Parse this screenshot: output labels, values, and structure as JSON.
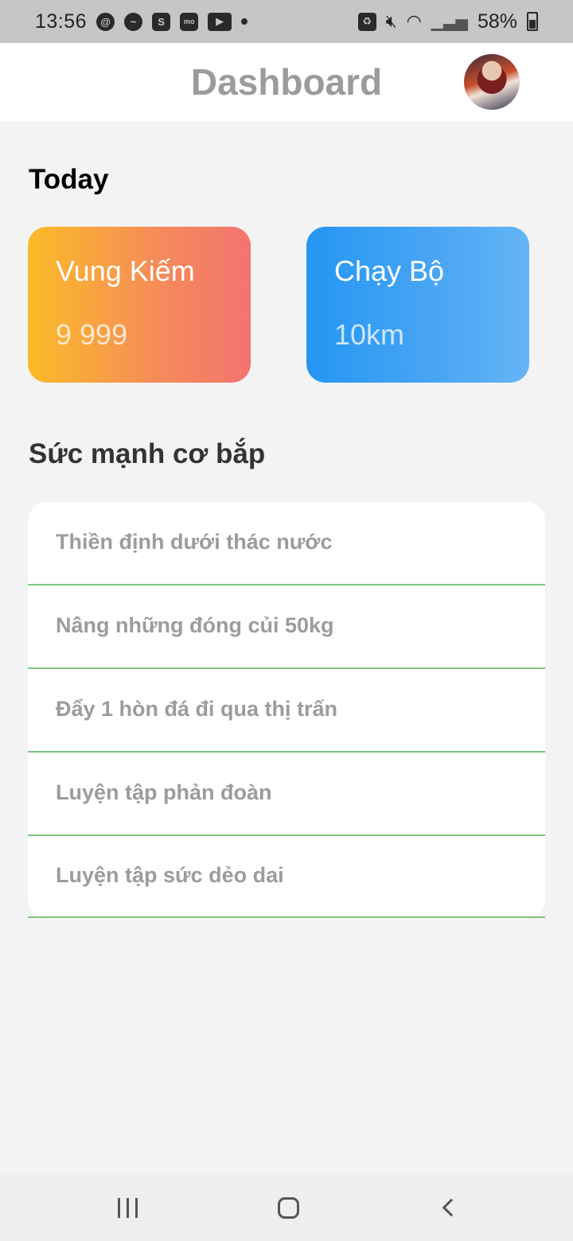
{
  "status_bar": {
    "time": "13:56",
    "battery_pct": "58%",
    "icons": [
      "threads-icon",
      "messenger-icon",
      "shopee-icon",
      "momo-icon",
      "youtube-icon",
      "notification-dot",
      "battery-saver-icon",
      "mute-icon",
      "wifi-icon",
      "signal-icon",
      "battery-icon"
    ],
    "momo_text": "mo mo"
  },
  "app_bar": {
    "title": "Dashboard"
  },
  "today": {
    "heading": "Today",
    "cards": [
      {
        "title": "Vung Kiếm",
        "value": "9 999",
        "gradient": [
          "#fbbb28",
          "#f47370"
        ]
      },
      {
        "title": "Chạy Bộ",
        "value": "10km",
        "gradient": [
          "#2496f3",
          "#65b5f5"
        ]
      }
    ]
  },
  "strength": {
    "heading": "Sức mạnh cơ bắp",
    "items": [
      "Thiền định dưới thác nước",
      "Nâng những đóng củi 50kg",
      "Đẩy 1 hòn đá đi qua thị trấn",
      "Luyện tập phản đoàn",
      "Luyện tập sức dẻo dai"
    ],
    "divider_color": "#7dc47f"
  },
  "nav_bar": {
    "buttons": [
      "recent-apps",
      "home",
      "back"
    ]
  }
}
